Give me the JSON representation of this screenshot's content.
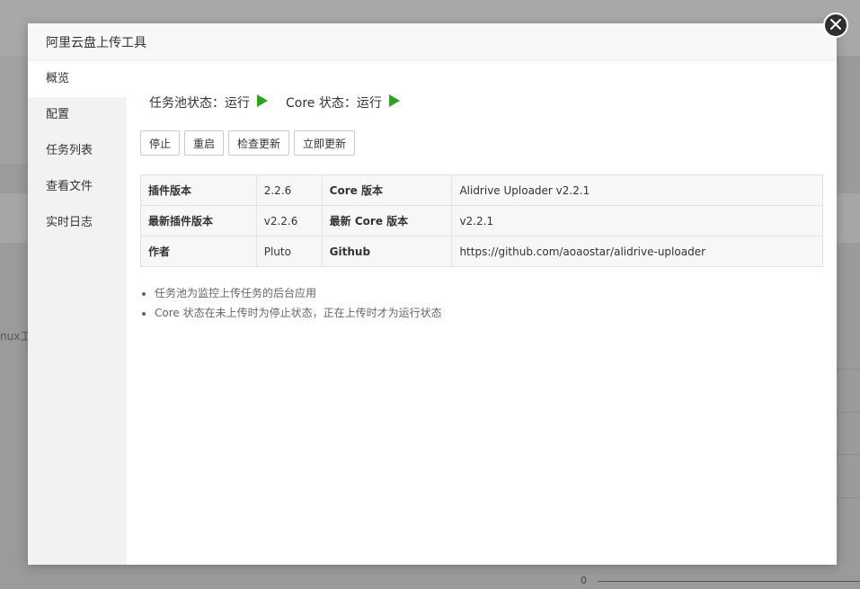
{
  "backdrop": {
    "partial_text": "nux工",
    "axis_zero": "0"
  },
  "modal": {
    "title": "阿里云盘上传工具",
    "close_icon": "close-icon"
  },
  "sidebar": {
    "items": [
      {
        "label": "概览",
        "active": true
      },
      {
        "label": "配置",
        "active": false
      },
      {
        "label": "任务列表",
        "active": false
      },
      {
        "label": "查看文件",
        "active": false
      },
      {
        "label": "实时日志",
        "active": false
      }
    ]
  },
  "status": {
    "task_pool_label": "任务池状态：运行",
    "core_label": "Core 状态：运行",
    "running_color": "#2ea121",
    "icon": "play-icon"
  },
  "buttons": {
    "stop": "停止",
    "restart": "重启",
    "check_update": "检查更新",
    "update_now": "立即更新"
  },
  "info_table": {
    "rows": [
      [
        "插件版本",
        "2.2.6",
        "Core 版本",
        "Alidrive Uploader v2.2.1"
      ],
      [
        "最新插件版本",
        "v2.2.6",
        "最新 Core 版本",
        "v2.2.1"
      ],
      [
        "作者",
        "Pluto",
        "Github",
        "https://github.com/aoaostar/alidrive-uploader"
      ]
    ]
  },
  "notes": [
    "任务池为监控上传任务的后台应用",
    "Core 状态在未上传时为停止状态，正在上传时才为运行状态"
  ]
}
